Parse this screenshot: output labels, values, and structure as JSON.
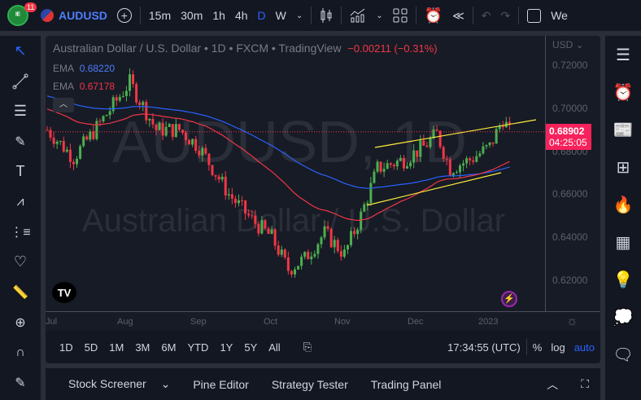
{
  "toolbar": {
    "notification_count": "11",
    "symbol": "AUDUSD",
    "intervals": [
      "15m",
      "30m",
      "1h",
      "4h",
      "D",
      "W"
    ],
    "active_interval": "D",
    "cut_label": "We"
  },
  "legend": {
    "title": "Australian Dollar / U.S. Dollar • 1D • FXCM • TradingView",
    "change": "−0.00211 (−0.31%)",
    "ema1_label": "EMA",
    "ema1_value": "0.68220",
    "ema2_label": "EMA",
    "ema2_value": "0.67178"
  },
  "watermark": {
    "symbol": "AUDUSD, 1D",
    "name": "Australian Dollar / U.S. Dollar"
  },
  "price_axis": {
    "currency": "USD",
    "ticks": [
      "0.72000",
      "0.70000",
      "0.68000",
      "0.66000",
      "0.64000",
      "0.62000"
    ],
    "last_price": "0.68902",
    "countdown": "04:25:05"
  },
  "time_axis": {
    "ticks": [
      "Jul",
      "Aug",
      "Sep",
      "Oct",
      "Nov",
      "Dec",
      "2023"
    ]
  },
  "range_bar": {
    "ranges": [
      "1D",
      "5D",
      "1M",
      "3M",
      "6M",
      "YTD",
      "1Y",
      "5Y",
      "All"
    ],
    "time": "17:34:55 (UTC)",
    "percent": "%",
    "log": "log",
    "auto": "auto"
  },
  "bottom_panel": {
    "tabs": [
      "Stock Screener",
      "Pine Editor",
      "Strategy Tester",
      "Trading Panel"
    ]
  },
  "colors": {
    "up": "#26a69a",
    "upc": "#4caf50",
    "down": "#f23645",
    "ema_fast": "#2962ff",
    "ema_slow": "#f23645",
    "trend": "#ffeb3b",
    "accent": "#2962ff",
    "price_label": "#f7215b"
  },
  "price_path": [
    [
      0,
      0.69
    ],
    [
      8,
      0.677
    ],
    [
      16,
      0.693
    ],
    [
      25,
      0.712
    ],
    [
      33,
      0.69
    ],
    [
      40,
      0.69
    ],
    [
      46,
      0.682
    ],
    [
      55,
      0.66
    ],
    [
      62,
      0.648
    ],
    [
      68,
      0.64
    ],
    [
      73,
      0.625
    ],
    [
      78,
      0.63
    ],
    [
      84,
      0.642
    ],
    [
      90,
      0.632
    ],
    [
      95,
      0.65
    ],
    [
      100,
      0.672
    ],
    [
      108,
      0.676
    ],
    [
      114,
      0.682
    ],
    [
      118,
      0.688
    ],
    [
      122,
      0.672
    ],
    [
      128,
      0.676
    ],
    [
      134,
      0.682
    ],
    [
      138,
      0.695
    ],
    [
      140,
      0.689
    ]
  ]
}
